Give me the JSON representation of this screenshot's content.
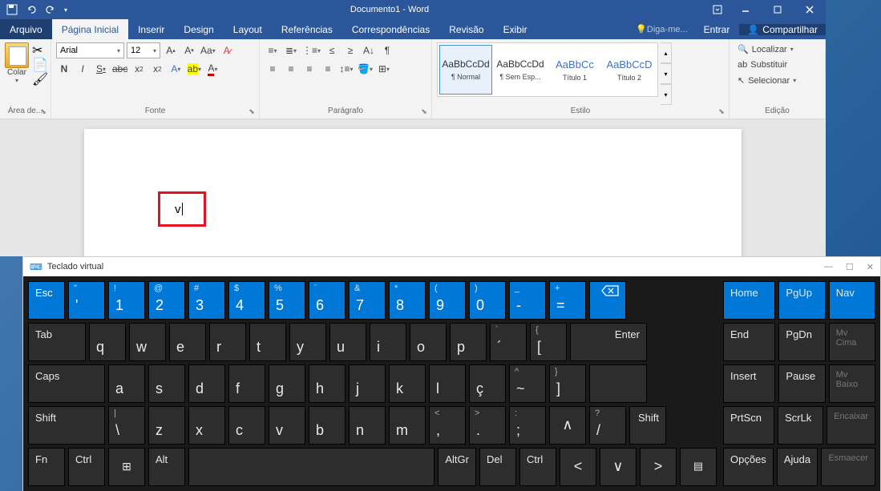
{
  "word": {
    "title": "Documento1 - Word",
    "menu": {
      "arquivo": "Arquivo",
      "pagina_inicial": "Página Inicial",
      "inserir": "Inserir",
      "design": "Design",
      "layout": "Layout",
      "referencias": "Referências",
      "correspondencias": "Correspondências",
      "revisao": "Revisão",
      "exibir": "Exibir",
      "tellme": "Diga-me...",
      "entrar": "Entrar",
      "compartilhar": "Compartilhar"
    },
    "ribbon": {
      "clipboard": {
        "colar": "Colar",
        "label": "Área de..."
      },
      "font": {
        "name": "Arial",
        "size": "12",
        "label": "Fonte"
      },
      "paragraph": {
        "label": "Parágrafo"
      },
      "styles": {
        "label": "Estilo",
        "preview": "AaBbCcDd",
        "preview_short": "AaBbCc",
        "preview_short2": "AaBbCcD",
        "normal": "¶ Normal",
        "semesp": "¶ Sem Esp...",
        "titulo1": "Título 1",
        "titulo2": "Título 2"
      },
      "editing": {
        "label": "Edição",
        "localizar": "Localizar",
        "substituir": "Substituir",
        "selecionar": "Selecionar"
      }
    },
    "doc": {
      "typed": "v"
    }
  },
  "osk": {
    "title": "Teclado virtual",
    "row1": {
      "esc": "Esc",
      "k1": {
        "s": "!",
        "m": "1"
      },
      "k2": {
        "s": "@",
        "m": "2"
      },
      "k3": {
        "s": "#",
        "m": "3"
      },
      "k4": {
        "s": "$",
        "m": "4"
      },
      "k5": {
        "s": "%",
        "m": "5"
      },
      "k6": {
        "s": "¨",
        "m": "6"
      },
      "k7": {
        "s": "&",
        "m": "7"
      },
      "k8": {
        "s": "*",
        "m": "8"
      },
      "k9": {
        "s": "(",
        "m": "9"
      },
      "k0": {
        "s": ")",
        "m": "0"
      },
      "kmin": {
        "s": "_",
        "m": "-"
      },
      "keq": {
        "s": "+",
        "m": "="
      }
    },
    "row2": {
      "tab": "Tab",
      "q": "q",
      "w": "w",
      "e": "e",
      "r": "r",
      "t": "t",
      "y": "y",
      "u": "u",
      "i": "i",
      "o": "o",
      "p": "p",
      "acc": {
        "s": "`",
        "m": "´"
      },
      "br": {
        "s": "{",
        "m": "["
      },
      "enter": "Enter"
    },
    "row3": {
      "caps": "Caps",
      "a": "a",
      "s": "s",
      "d": "d",
      "f": "f",
      "g": "g",
      "h": "h",
      "j": "j",
      "k": "k",
      "l": "l",
      "cc": "ç",
      "til": {
        "s": "^",
        "m": "~"
      },
      "br2": {
        "s": "}",
        "m": "]"
      }
    },
    "row4": {
      "shift": "Shift",
      "bs": {
        "s": "|",
        "m": "\\"
      },
      "z": "z",
      "x": "x",
      "c": "c",
      "v": "v",
      "b": "b",
      "n": "n",
      "m": "m",
      "com": {
        "s": "<",
        "m": ","
      },
      "dot": {
        "s": ">",
        "m": "."
      },
      "sc": {
        "s": ":",
        "m": ";"
      },
      "sl": {
        "s": "?",
        "m": "/"
      },
      "shift2": "Shift"
    },
    "row5": {
      "fn": "Fn",
      "ctrl": "Ctrl",
      "alt": "Alt",
      "altgr": "AltGr",
      "del": "Del",
      "ctrl2": "Ctrl"
    },
    "side": {
      "home": "Home",
      "pgup": "PgUp",
      "nav": "Nav",
      "end": "End",
      "pgdn": "PgDn",
      "mvcima": "Mv Cima",
      "insert": "Insert",
      "pause": "Pause",
      "mvbaixo": "Mv Baixo",
      "prtscn": "PrtScn",
      "scrlk": "ScrLk",
      "encaixar": "Encaixar",
      "opcoes": "Opções",
      "ajuda": "Ajuda",
      "esmaecer": "Esmaecer"
    }
  }
}
